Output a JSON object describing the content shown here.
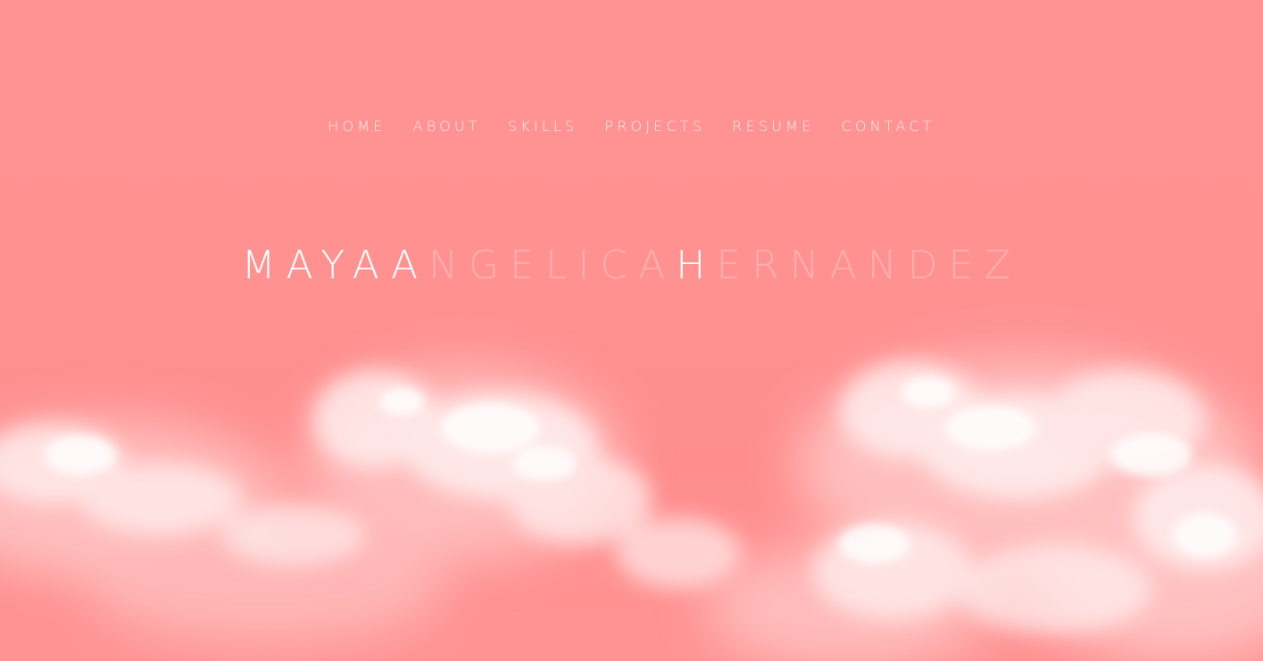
{
  "nav": {
    "items": [
      {
        "label": "HOME"
      },
      {
        "label": "ABOUT"
      },
      {
        "label": "SKILLS"
      },
      {
        "label": "PROJECTS"
      },
      {
        "label": "RESUME"
      },
      {
        "label": "CONTACT"
      }
    ]
  },
  "hero": {
    "name_part1": "MAYAA",
    "name_part2": "NGELICA",
    "name_part3": "H",
    "name_part4": "ERNANDEZ",
    "background_color": "#ff9090"
  }
}
